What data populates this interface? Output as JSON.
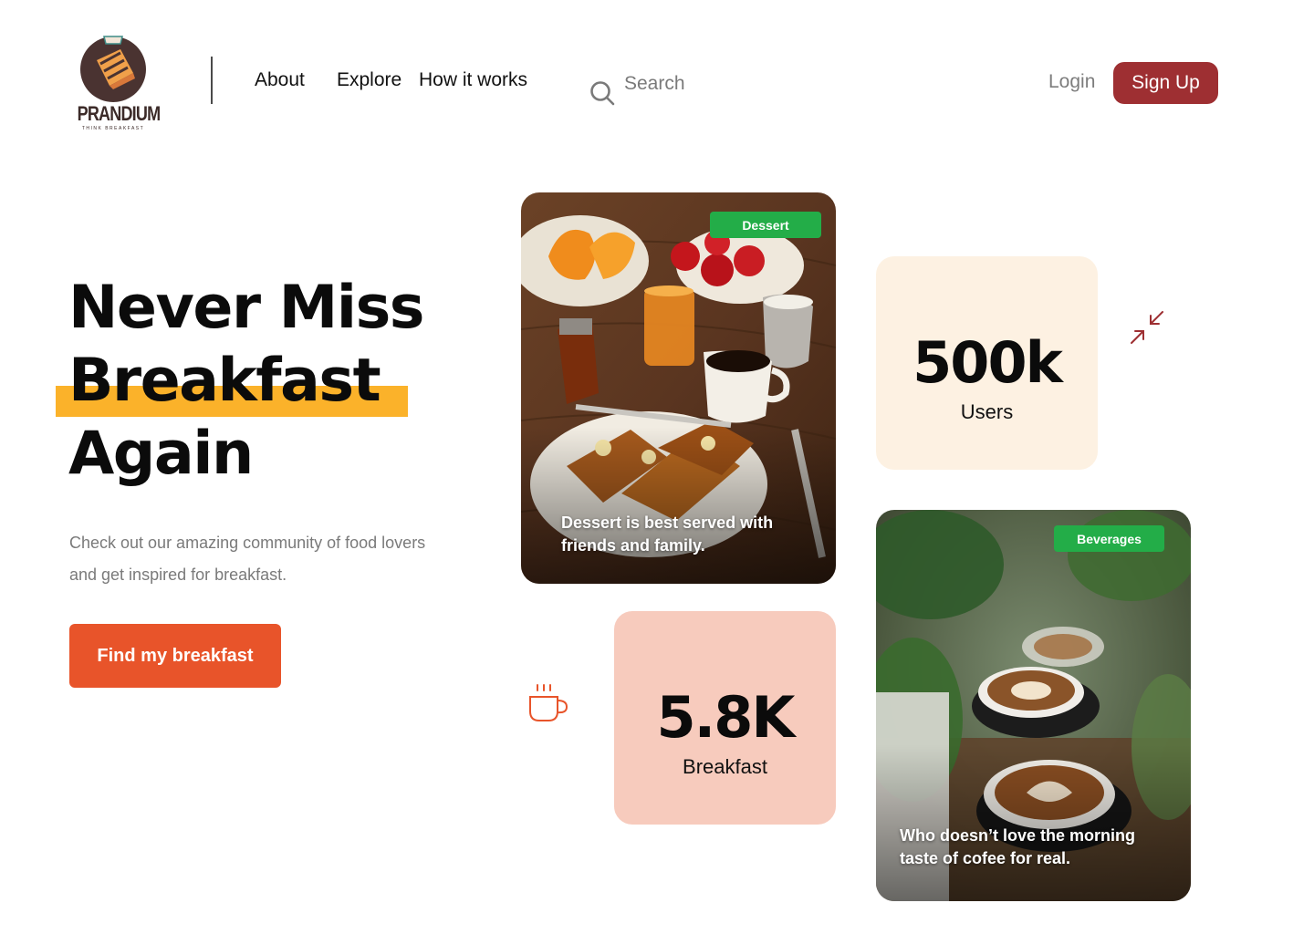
{
  "brand": {
    "name": "PRANDIUM",
    "tagline": "THINK BREAKFAST",
    "logo_icon": "toast-logo-icon"
  },
  "nav": {
    "items": [
      {
        "label": "About"
      },
      {
        "label": "Explore"
      },
      {
        "label": "How it works"
      }
    ]
  },
  "search": {
    "placeholder": "Search",
    "icon": "search-icon"
  },
  "auth": {
    "login_label": "Login",
    "signup_label": "Sign Up"
  },
  "hero": {
    "title_line1": "Never Miss",
    "title_line2": "Breakfast",
    "title_line3": "Again",
    "subtitle": "Check out our amazing community of food lovers and get inspired for breakfast.",
    "cta_label": "Find my breakfast"
  },
  "cards": {
    "dessert": {
      "badge": "Dessert",
      "caption": "Dessert is best served with friends and family."
    },
    "beverages": {
      "badge": "Beverages",
      "caption": "Who doesn’t love the morning taste of cofee for real."
    }
  },
  "stats": {
    "users": {
      "value": "500k",
      "label": "Users"
    },
    "breakfast": {
      "value": "5.8K",
      "label": "Breakfast"
    }
  },
  "icons": {
    "collapse": "collapse-arrows-icon",
    "cup": "coffee-cup-icon"
  },
  "colors": {
    "brand_red": "#9e2f32",
    "cta_orange": "#e8542a",
    "highlight_yellow": "#fbb22a",
    "badge_green": "#23ad48",
    "users_card_bg": "#fdf1e2",
    "breakfast_card_bg": "#f7cbbd"
  }
}
